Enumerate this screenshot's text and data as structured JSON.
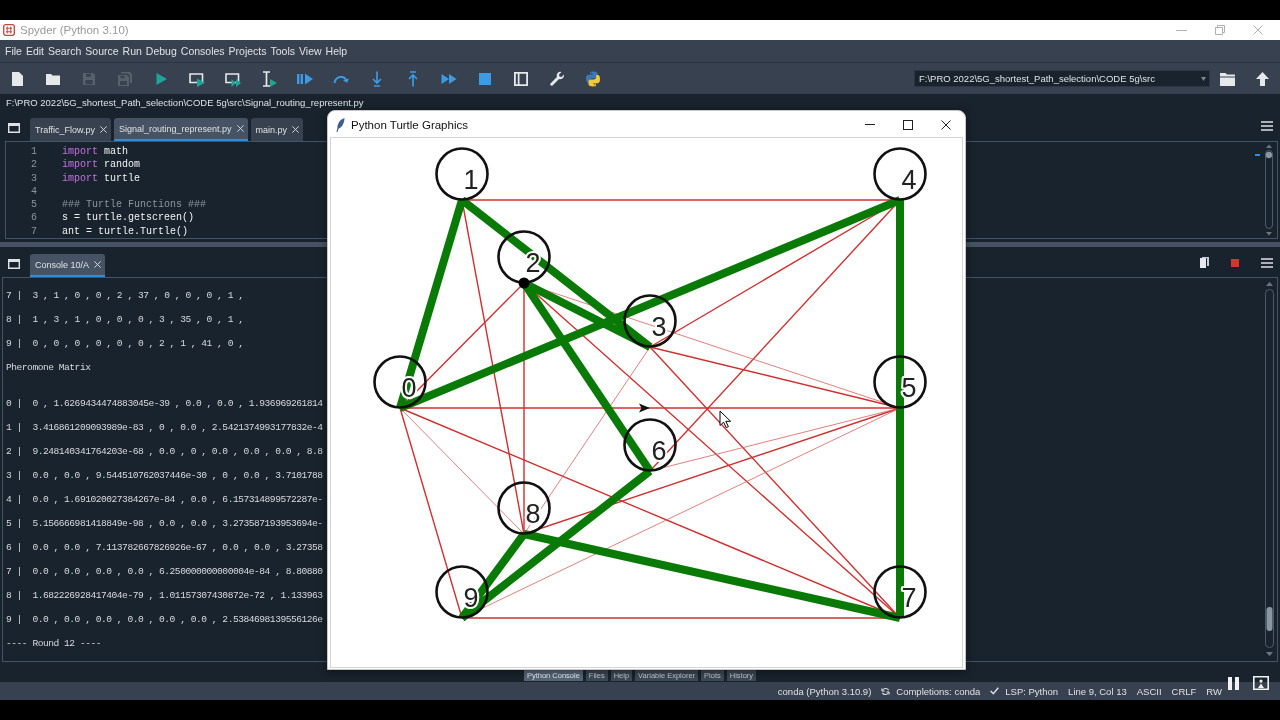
{
  "window": {
    "title": "Spyder (Python 3.10)"
  },
  "menu": [
    "File",
    "Edit",
    "Search",
    "Source",
    "Run",
    "Debug",
    "Consoles",
    "Projects",
    "Tools",
    "View",
    "Help"
  ],
  "toolbar": [
    {
      "kind": "new-file",
      "disabled": false
    },
    {
      "kind": "open",
      "disabled": false
    },
    {
      "kind": "save",
      "disabled": true
    },
    {
      "kind": "save-all",
      "disabled": true
    },
    {
      "kind": "run",
      "disabled": false
    },
    {
      "kind": "run-cell",
      "disabled": false
    },
    {
      "kind": "run-cell-advance",
      "disabled": false
    },
    {
      "kind": "run-selection",
      "disabled": false
    },
    {
      "kind": "debug",
      "disabled": false
    },
    {
      "kind": "step",
      "disabled": false
    },
    {
      "kind": "step-into",
      "disabled": false
    },
    {
      "kind": "step-out",
      "disabled": false
    },
    {
      "kind": "continue",
      "disabled": false
    },
    {
      "kind": "stop",
      "disabled": false
    },
    {
      "kind": "maximize",
      "disabled": false
    },
    {
      "kind": "preferences",
      "disabled": false
    },
    {
      "kind": "python-path",
      "disabled": false
    }
  ],
  "working_directory": {
    "value": "F:\\PRO 2022\\5G_shortest_Path_selection\\CODE 5g\\src"
  },
  "file_path": "F:\\PRO 2022\\5G_shortest_Path_selection\\CODE 5g\\src\\Signal_routing_represent.py",
  "editor": {
    "tabs": [
      {
        "label": "Traffic_Flow.py",
        "selected": false
      },
      {
        "label": "Signal_routing_represent.py",
        "selected": true
      },
      {
        "label": "main.py",
        "selected": false
      }
    ],
    "lines": [
      {
        "number": "1",
        "tokens": [
          {
            "kind": "keyword",
            "text": "import"
          },
          {
            "kind": "plain",
            "text": "math"
          }
        ]
      },
      {
        "number": "2",
        "tokens": [
          {
            "kind": "keyword",
            "text": "import"
          },
          {
            "kind": "plain",
            "text": "random"
          }
        ]
      },
      {
        "number": "3",
        "tokens": [
          {
            "kind": "keyword",
            "text": "import"
          },
          {
            "kind": "plain",
            "text": "turtle"
          }
        ]
      },
      {
        "number": "4"
      },
      {
        "number": "5",
        "tokens": [
          {
            "kind": "comment",
            "text": "### Turtle Functions ###"
          }
        ]
      },
      {
        "number": "6",
        "tokens": [
          {
            "kind": "plain",
            "text": "s = turtle.getscreen()"
          }
        ]
      },
      {
        "number": "7",
        "tokens": [
          {
            "kind": "plain",
            "text": "ant = turtle.Turtle()"
          }
        ]
      }
    ]
  },
  "console": {
    "tabs": [
      {
        "label": "Console 10/A",
        "selected": true
      }
    ],
    "lines": [
      {
        "kind": "row",
        "text": "7 |  3 , 1 , 0 , 0 , 2 , 37 , 0 , 0 , 0 , 1 ,"
      },
      {
        "kind": "row",
        "text": "8 |  1 , 3 , 1 , 0 , 0 , 0 , 3 , 35 , 0 , 1 ,"
      },
      {
        "kind": "row",
        "text": "9 |  0 , 0 , 0 , 0 , 0 , 0 , 2 , 1 , 41 , 0 ,"
      },
      {
        "kind": "caption",
        "text": "Pheromone Matrix"
      },
      {
        "kind": "row",
        "text": "0 |  0 , 1.6269434474883045e-39 , 0.0 , 0.0 , 1.936969261814"
      },
      {
        "kind": "row",
        "text": "1 |  3.416861209093989e-83 , 0 , 0.0 , 2.5421374993177832e-4"
      },
      {
        "kind": "row",
        "text": "2 |  9.248140341764203e-68 , 0.0 , 0 , 0.0 , 0.0 , 0.0 , 8.8"
      },
      {
        "kind": "row",
        "text": "3 |  0.0 , 0.0 , 9.544510762037446e-30 , 0 , 0.0 , 3.7101788"
      },
      {
        "kind": "row",
        "text": "4 |  0.0 , 1.691020027384267e-84 , 0.0 , 6.157314899572287e-"
      },
      {
        "kind": "row",
        "text": "5 |  5.156666981418849e-98 , 0.0 , 0.0 , 3.273587193953694e-"
      },
      {
        "kind": "row",
        "text": "6 |  0.0 , 0.0 , 7.113782667826926e-67 , 0.0 , 0.0 , 3.27358"
      },
      {
        "kind": "row",
        "text": "7 |  0.0 , 0.0 , 0.0 , 0.0 , 6.250000000000004e-84 , 8.80880"
      },
      {
        "kind": "row",
        "text": "8 |  1.682226928417404e-79 , 1.01157307430872e-72 , 1.133963"
      },
      {
        "kind": "row",
        "text": "9 |  0.0 , 0.0 , 0.0 , 0.0 , 0.0 , 0.0 , 2.5384698139556126e"
      },
      {
        "kind": "caption",
        "text": "---- Round 12 ----"
      }
    ]
  },
  "pane_tabs": [
    {
      "label": "Python Console",
      "selected": true
    },
    {
      "label": "Files",
      "selected": false
    },
    {
      "label": "Help",
      "selected": false
    },
    {
      "label": "Variable Explorer",
      "selected": false
    },
    {
      "label": "Plots",
      "selected": false
    },
    {
      "label": "History",
      "selected": false
    }
  ],
  "status_bar": [
    {
      "kind": "text",
      "text": "conda (Python 3.10.9)"
    },
    {
      "kind": "sync",
      "text": "Completions: conda"
    },
    {
      "kind": "check",
      "text": "LSP: Python"
    },
    {
      "kind": "text",
      "text": "Line 9, Col 13"
    },
    {
      "kind": "text",
      "text": "ASCII"
    },
    {
      "kind": "text",
      "text": "CRLF"
    },
    {
      "kind": "text",
      "text": "RW"
    }
  ],
  "turtle_window": {
    "title": "Python Turtle Graphics",
    "nodes": [
      {
        "label": "0"
      },
      {
        "label": "1"
      },
      {
        "label": "2"
      },
      {
        "label": "3"
      },
      {
        "label": "4"
      },
      {
        "label": "5"
      },
      {
        "label": "6"
      },
      {
        "label": "7"
      },
      {
        "label": "8"
      },
      {
        "label": "9"
      }
    ],
    "edges": [
      {
        "kind": "link"
      },
      {
        "kind": "link"
      },
      {
        "kind": "link"
      },
      {
        "kind": "link"
      },
      {
        "kind": "link"
      },
      {
        "kind": "link"
      },
      {
        "kind": "link"
      },
      {
        "kind": "link"
      },
      {
        "kind": "link"
      },
      {
        "kind": "link"
      },
      {
        "kind": "link"
      },
      {
        "kind": "link"
      },
      {
        "kind": "link"
      },
      {
        "kind": "link"
      },
      {
        "kind": "faint"
      },
      {
        "kind": "faint"
      },
      {
        "kind": "faint"
      },
      {
        "kind": "faint"
      },
      {
        "kind": "faint"
      },
      {
        "kind": "route"
      },
      {
        "kind": "route"
      },
      {
        "kind": "route"
      },
      {
        "kind": "route"
      },
      {
        "kind": "route"
      },
      {
        "kind": "route"
      },
      {
        "kind": "route"
      },
      {
        "kind": "route"
      },
      {
        "kind": "route"
      }
    ]
  }
}
